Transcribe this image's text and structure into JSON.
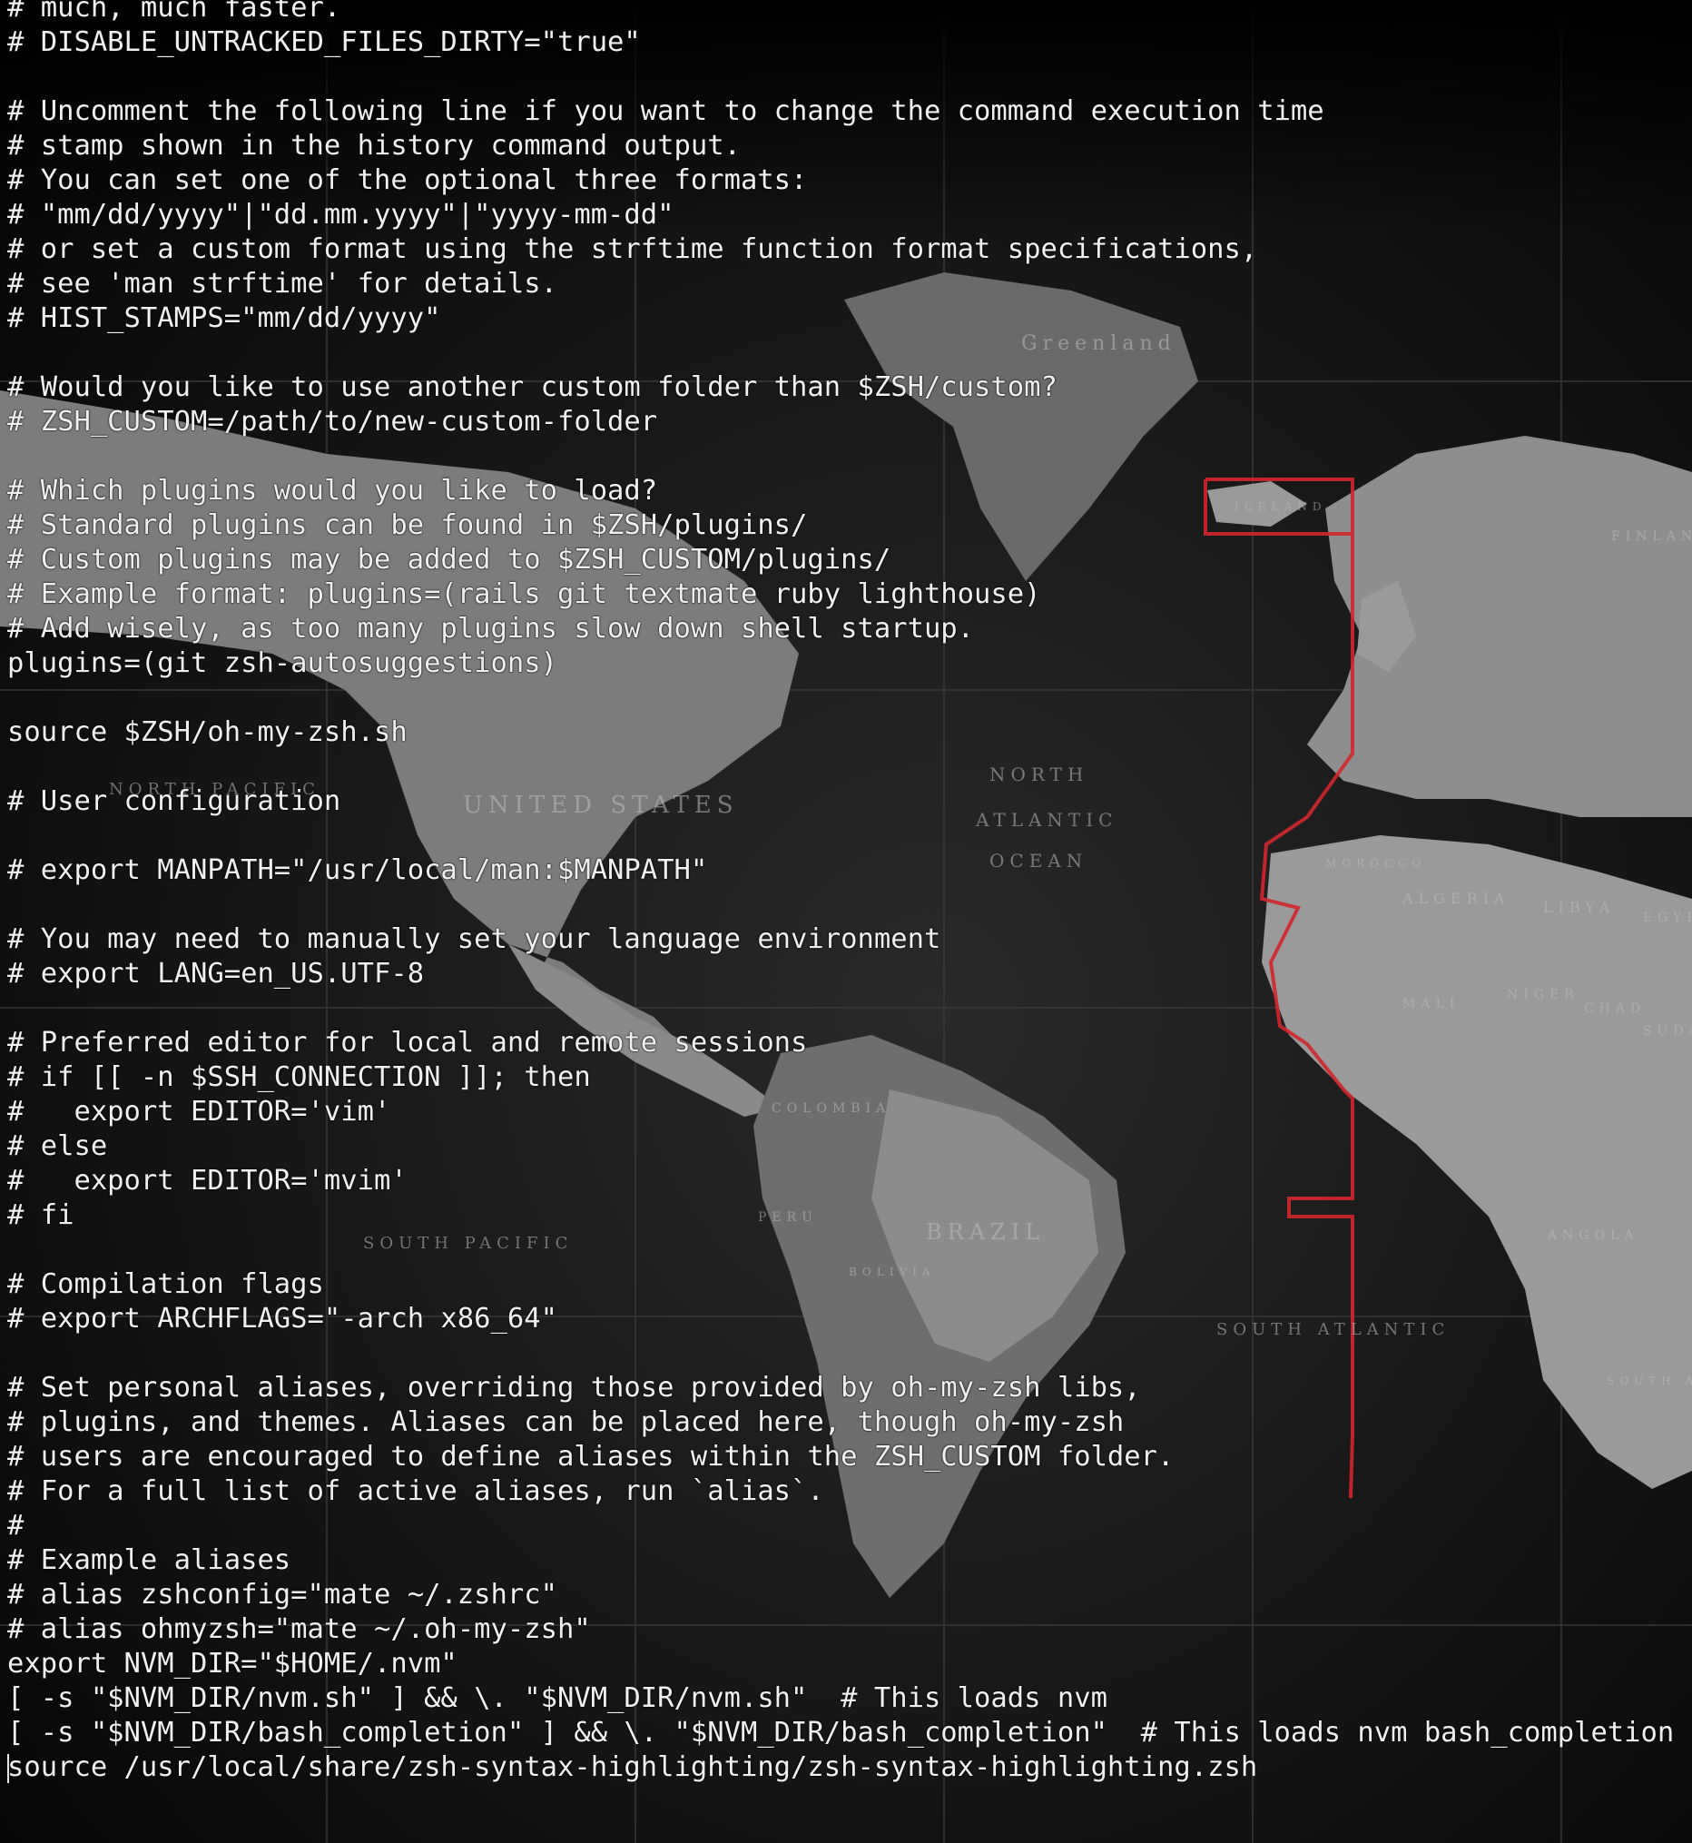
{
  "terminal": {
    "lines": [
      "# much, much faster.",
      "# DISABLE_UNTRACKED_FILES_DIRTY=\"true\"",
      "",
      "# Uncomment the following line if you want to change the command execution time",
      "# stamp shown in the history command output.",
      "# You can set one of the optional three formats:",
      "# \"mm/dd/yyyy\"|\"dd.mm.yyyy\"|\"yyyy-mm-dd\"",
      "# or set a custom format using the strftime function format specifications,",
      "# see 'man strftime' for details.",
      "# HIST_STAMPS=\"mm/dd/yyyy\"",
      "",
      "# Would you like to use another custom folder than $ZSH/custom?",
      "# ZSH_CUSTOM=/path/to/new-custom-folder",
      "",
      "# Which plugins would you like to load?",
      "# Standard plugins can be found in $ZSH/plugins/",
      "# Custom plugins may be added to $ZSH_CUSTOM/plugins/",
      "# Example format: plugins=(rails git textmate ruby lighthouse)",
      "# Add wisely, as too many plugins slow down shell startup.",
      "plugins=(git zsh-autosuggestions)",
      "",
      "source $ZSH/oh-my-zsh.sh",
      "",
      "# User configuration",
      "",
      "# export MANPATH=\"/usr/local/man:$MANPATH\"",
      "",
      "# You may need to manually set your language environment",
      "# export LANG=en_US.UTF-8",
      "",
      "# Preferred editor for local and remote sessions",
      "# if [[ -n $SSH_CONNECTION ]]; then",
      "#   export EDITOR='vim'",
      "# else",
      "#   export EDITOR='mvim'",
      "# fi",
      "",
      "# Compilation flags",
      "# export ARCHFLAGS=\"-arch x86_64\"",
      "",
      "# Set personal aliases, overriding those provided by oh-my-zsh libs,",
      "# plugins, and themes. Aliases can be placed here, though oh-my-zsh",
      "# users are encouraged to define aliases within the ZSH_CUSTOM folder.",
      "# For a full list of active aliases, run `alias`.",
      "#",
      "# Example aliases",
      "# alias zshconfig=\"mate ~/.zshrc\"",
      "# alias ohmyzsh=\"mate ~/.oh-my-zsh\"",
      "export NVM_DIR=\"$HOME/.nvm\"",
      "[ -s \"$NVM_DIR/nvm.sh\" ] && \\. \"$NVM_DIR/nvm.sh\"  # This loads nvm",
      "[ -s \"$NVM_DIR/bash_completion\" ] && \\. \"$NVM_DIR/bash_completion\"  # This loads nvm bash_completion",
      "source /usr/local/share/zsh-syntax-highlighting/zsh-syntax-highlighting.zsh"
    ]
  },
  "map_labels": {
    "greenland": "Greenland",
    "iceland": "ICELAND",
    "finland": "FINLAND",
    "north_pacific": "NORTH PACIFIC",
    "united_states": "UNITED STATES",
    "north": "NORTH",
    "atlantic": "ATLANTIC",
    "ocean": "OCEAN",
    "algeria": "ALGERIA",
    "libya": "LIBYA",
    "egypt": "EGYPT",
    "morocco": "MOROCCO",
    "mali": "MALI",
    "niger": "NIGER",
    "chad": "CHAD",
    "sudan": "SUDAN",
    "colombia": "COLOMBIA",
    "peru": "PERU",
    "brazil": "BRAZIL",
    "bolivia": "BOLIVIA",
    "south_pacific": "SOUTH PACIFIC",
    "south_atlantic": "SOUTH ATLANTIC",
    "angola": "ANGOLA",
    "south_africa": "SOUTH AFRICA"
  },
  "colors": {
    "text": "#f0f0f0",
    "background": "#050505",
    "land_light": "#8a8a8a",
    "land_mid": "#5e5e5e",
    "ocean": "#141414",
    "border_red": "#d2262a"
  }
}
